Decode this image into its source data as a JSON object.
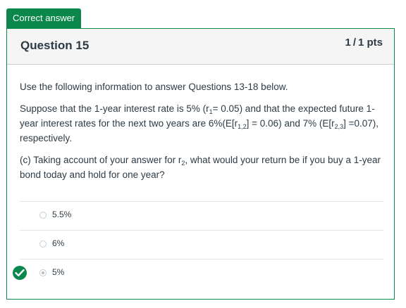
{
  "status_badge": "Correct answer",
  "question": {
    "title": "Question 15",
    "points_earned": "1",
    "points_total": "1 pts",
    "intro": "Use the following information to answer Questions 13-18 below.",
    "scenario": {
      "part1": "Suppose that the 1-year interest rate is 5% (r",
      "sub1": "1",
      "part2": "= 0.05) and that the expected future 1-year interest rates for the next two years are 6%(E[r",
      "sub2": "1,2",
      "part3": "] = 0.06) and 7% (E[r",
      "sub3": "2,3",
      "part4": "] =0.07), respectively."
    },
    "prompt": {
      "part1": "(c) Taking account of your answer for r",
      "sub1": "2",
      "part2": ", what would your return be if you buy a 1-year bond today and hold for one year?"
    }
  },
  "answers": [
    {
      "label": "5.5%",
      "selected": false,
      "correct": false
    },
    {
      "label": "6%",
      "selected": false,
      "correct": false
    },
    {
      "label": "5%",
      "selected": true,
      "correct": true
    }
  ],
  "colors": {
    "correct_green": "#0b874b",
    "header_bg": "#f5f5f5"
  }
}
